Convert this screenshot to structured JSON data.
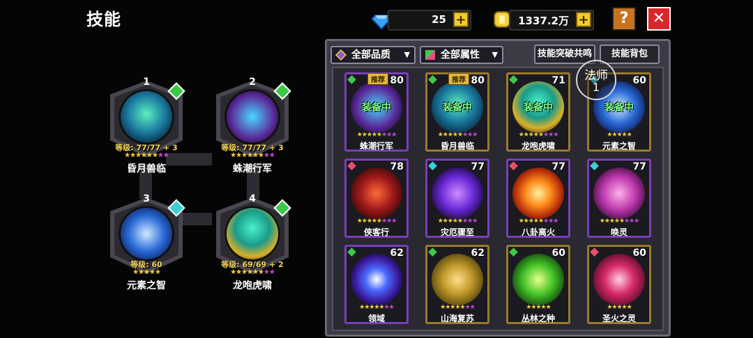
{
  "title": "技能",
  "resources": {
    "diamond_value": "25",
    "gold_value": "1337.2万",
    "plus": "+"
  },
  "buttons": {
    "help": "?",
    "close": "✕"
  },
  "colors": {
    "diamond": "#3aa0ff",
    "gold": "#f2cf3c",
    "help_bg": "#c8731f",
    "close_bg": "#d8262b",
    "equipped_text": "#7dff8a"
  },
  "equipped": [
    {
      "slot": "1",
      "level": "等级: 77/77 + 3",
      "name": "昏月兽临",
      "gem": "green",
      "stars": "★★★★★★★★",
      "icon": "beast-moon-icon"
    },
    {
      "slot": "2",
      "level": "等级: 77/77 + 3",
      "name": "蛛潮行军",
      "gem": "green",
      "stars": "★★★★★★★★",
      "icon": "spider-tide-icon"
    },
    {
      "slot": "3",
      "level": "等级: 60",
      "name": "元素之智",
      "gem": "cyan",
      "stars": "★★★★★",
      "icon": "element-wisdom-icon"
    },
    {
      "slot": "4",
      "level": "等级: 69/69 + 2",
      "name": "龙咆虎啸",
      "gem": "green",
      "stars": "★★★★★★★★",
      "icon": "dragon-tiger-icon"
    }
  ],
  "filters": {
    "quality": "全部品质",
    "attribute": "全部属性",
    "resonance": "技能突破共鸣",
    "bag": "技能背包"
  },
  "tooltip": {
    "line1": "法师",
    "line2": "1"
  },
  "skills": [
    {
      "name": "蛛潮行军",
      "level": "80",
      "tag": "推荐",
      "status": "装备中",
      "quality": "green",
      "stars": "★★★★★★★★",
      "border": "purple"
    },
    {
      "name": "昏月兽临",
      "level": "80",
      "tag": "推荐",
      "status": "装备中",
      "quality": "green",
      "stars": "★★★★★★★★",
      "border": "gold"
    },
    {
      "name": "龙咆虎啸",
      "level": "71",
      "tag": "",
      "status": "装备中",
      "quality": "green",
      "stars": "★★★★★★★★",
      "border": "gold"
    },
    {
      "name": "元素之智",
      "level": "60",
      "tag": "",
      "status": "装备中",
      "quality": "cyan",
      "stars": "★★★★★",
      "border": "gold"
    },
    {
      "name": "侠客行",
      "level": "78",
      "tag": "",
      "status": "",
      "quality": "red",
      "stars": "★★★★★★★★",
      "border": "purple"
    },
    {
      "name": "灾厄骤至",
      "level": "77",
      "tag": "",
      "status": "",
      "quality": "cyan",
      "stars": "★★★★★★★★",
      "border": "purple"
    },
    {
      "name": "八卦离火",
      "level": "77",
      "tag": "",
      "status": "",
      "quality": "red",
      "stars": "★★★★★★★★",
      "border": "purple"
    },
    {
      "name": "唤灵",
      "level": "77",
      "tag": "",
      "status": "",
      "quality": "cyan",
      "stars": "★★★★★★★★",
      "border": "purple"
    },
    {
      "name": "领域",
      "level": "62",
      "tag": "",
      "status": "",
      "quality": "green",
      "stars": "★★★★★★★",
      "border": "purple"
    },
    {
      "name": "山海复苏",
      "level": "62",
      "tag": "",
      "status": "",
      "quality": "green",
      "stars": "★★★★★★★",
      "border": "gold"
    },
    {
      "name": "丛林之种",
      "level": "60",
      "tag": "",
      "status": "",
      "quality": "green",
      "stars": "★★★★★",
      "border": "gold"
    },
    {
      "name": "圣火之灵",
      "level": "60",
      "tag": "",
      "status": "",
      "quality": "red",
      "stars": "★★★★★",
      "border": "gold"
    }
  ]
}
